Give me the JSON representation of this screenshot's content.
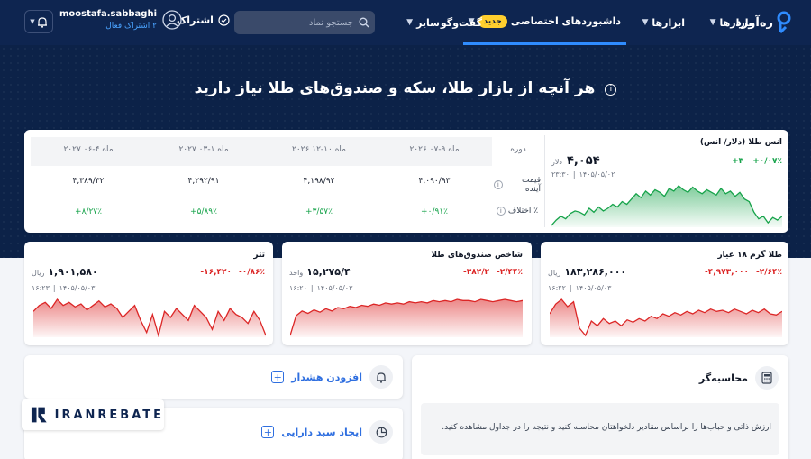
{
  "header": {
    "logo_text": "ره‌آورد",
    "nav": [
      {
        "label": "بازارها",
        "has_chevron": true
      },
      {
        "label": "ابزارها",
        "has_chevron": true
      },
      {
        "label": "داشبوردهای اختصاصی",
        "badge": "جدید",
        "has_chevron": true,
        "active": true
      },
      {
        "label": "گفت‌وگو",
        "has_chevron": false
      },
      {
        "label": "سایر",
        "has_chevron": true
      }
    ],
    "search_placeholder": "جستجو نماد",
    "subscribe_label": "اشتراک",
    "user": {
      "name": "moostafa.sabbaghi",
      "subscription": "۲ اشتراک فعال"
    },
    "accent_color": "#2f8cff",
    "badge_color": "#ffcf2e"
  },
  "hero": {
    "title": "هر آنچه از بازار طلا، سکه و صندوق‌های طلا نیاز دارید"
  },
  "ounce_card": {
    "title": "انس طلا (دلار/ انس)",
    "price": "۴,۰۵۴",
    "unit": "دلار",
    "change": "+۳",
    "change_pct": "+۰/۰۷٪",
    "date": "۱۴۰۵/۰۵/۰۲",
    "time": "۲۳:۳۰",
    "chart_data": {
      "type": "area",
      "color": "#16a34a",
      "values": [
        20,
        24,
        27,
        25,
        29,
        31,
        30,
        28,
        33,
        30,
        34,
        31,
        33,
        36,
        34,
        38,
        36,
        40,
        44,
        41,
        46,
        43,
        47,
        45,
        42,
        48,
        46,
        50,
        47,
        45,
        49,
        46,
        44,
        47,
        45,
        43,
        48,
        44,
        46,
        42,
        45,
        40,
        38,
        30,
        25,
        27,
        22,
        26,
        24,
        27
      ]
    }
  },
  "futures_table": {
    "headers": [
      "دوره",
      "ماه ۹-۰۷ ۲۰۲۶",
      "ماه ۱۰-۱۲ ۲۰۲۶",
      "ماه ۱-۰۳ ۲۰۲۷",
      "ماه ۴-۰۶ ۲۰۲۷"
    ],
    "rows": [
      {
        "label": "قیمت آینده",
        "values": [
          "۴,۰۹۰/۹۳",
          "۴,۱۹۸/۹۲",
          "۴,۲۹۲/۹۱",
          "۴,۳۸۹/۳۲"
        ]
      },
      {
        "label": "٪ اختلاف",
        "values": [
          "+۰/۹۱٪",
          "+۳/۵۷٪",
          "+۵/۸۹٪",
          "+۸/۲۷٪"
        ]
      }
    ]
  },
  "mini_cards": [
    {
      "title": "طلا گرم ۱۸ عیار",
      "price": "۱۸۳,۲۸۶,۰۰۰",
      "unit": "ریال",
      "change": "-۴,۹۷۳,۰۰۰",
      "change_pct": "-۲/۶۴٪",
      "date": "۱۴۰۵/۰۵/۰۳",
      "time": "۱۶:۲۲",
      "chart_data": {
        "type": "area",
        "color": "#dc2626",
        "values": [
          30,
          38,
          42,
          36,
          40,
          18,
          12,
          24,
          20,
          26,
          22,
          24,
          20,
          25,
          23,
          26,
          24,
          28,
          26,
          30,
          28,
          31,
          29,
          32,
          30,
          33,
          31,
          34,
          32,
          33,
          31,
          34,
          32,
          30,
          33,
          31,
          34,
          30,
          29,
          32
        ]
      }
    },
    {
      "title": "شاخص صندوق‌های طلا",
      "price": "۱۵,۲۷۵/۴",
      "unit": "واحد",
      "change": "-۳۸۲/۲",
      "change_pct": "-۲/۴۴٪",
      "date": "۱۴۰۵/۰۵/۰۳",
      "time": "۱۶:۲۰",
      "chart_data": {
        "type": "area",
        "color": "#dc2626",
        "values": [
          5,
          22,
          26,
          24,
          27,
          25,
          28,
          26,
          29,
          28,
          30,
          29,
          31,
          30,
          32,
          31,
          33,
          32,
          33,
          32,
          34,
          33,
          34,
          33,
          35,
          34,
          35,
          34,
          36,
          35,
          35,
          34,
          36,
          35,
          34,
          35,
          36,
          35,
          34,
          35
        ]
      }
    },
    {
      "title": "تتر",
      "price": "۱,۹۰۱,۵۸۰",
      "unit": "ریال",
      "change": "-۱۶,۴۲۰",
      "change_pct": "-۰/۸۶٪",
      "date": "۱۴۰۵/۰۵/۰۳",
      "time": "۱۶:۲۳",
      "chart_data": {
        "type": "area",
        "color": "#dc2626",
        "values": [
          26,
          30,
          32,
          28,
          34,
          30,
          32,
          29,
          31,
          27,
          30,
          33,
          29,
          31,
          28,
          22,
          26,
          30,
          20,
          12,
          24,
          10,
          26,
          22,
          28,
          24,
          20,
          30,
          26,
          22,
          14,
          26,
          20,
          28,
          24,
          22,
          18,
          26,
          20,
          10
        ]
      }
    }
  ],
  "actions": {
    "add_alert": "افزودن هشدار",
    "create_portfolio": "ایجاد سبد دارایی"
  },
  "calculator": {
    "title": "محاسبه‌گر",
    "description": "ارزش ذاتی و حباب‌ها را براساس مقادیر دلخواهتان محاسبه کنید و نتیجه را در جداول مشاهده کنید."
  },
  "watermark": {
    "text": "IRANREBATE"
  }
}
